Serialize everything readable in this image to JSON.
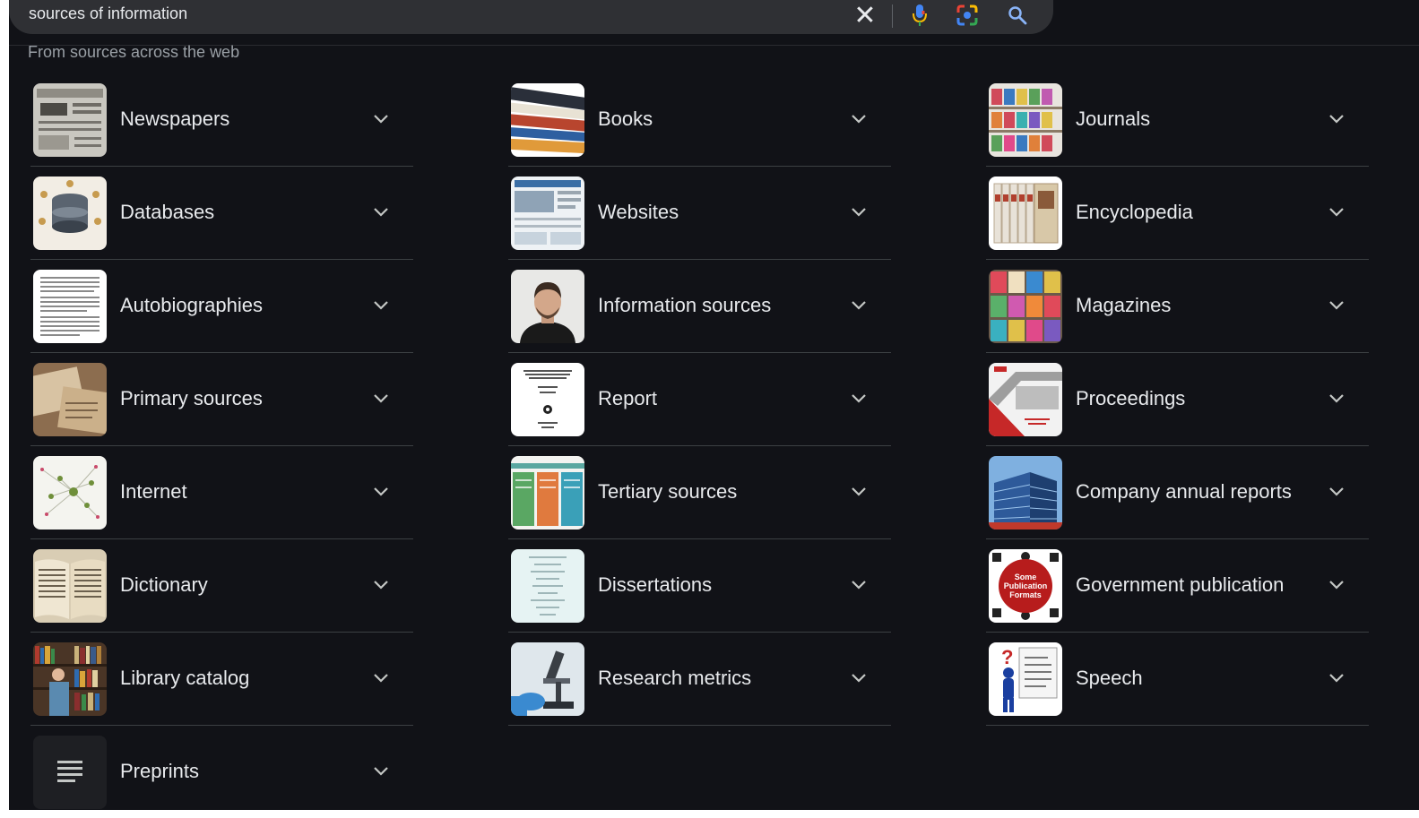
{
  "search": {
    "query": "sources of information"
  },
  "section_label": "From sources across the web",
  "columns": [
    [
      {
        "label": "Newspapers",
        "thumb": "newspaper-thumbnail"
      },
      {
        "label": "Databases",
        "thumb": "database-thumbnail"
      },
      {
        "label": "Autobiographies",
        "thumb": "document-page-thumbnail"
      },
      {
        "label": "Primary sources",
        "thumb": "old-papers-thumbnail"
      },
      {
        "label": "Internet",
        "thumb": "network-map-thumbnail"
      },
      {
        "label": "Dictionary",
        "thumb": "open-book-thumbnail"
      },
      {
        "label": "Library catalog",
        "thumb": "library-shelves-thumbnail"
      },
      {
        "label": "Preprints",
        "thumb": "lines-icon"
      }
    ],
    [
      {
        "label": "Books",
        "thumb": "book-stack-thumbnail"
      },
      {
        "label": "Websites",
        "thumb": "webpage-thumbnail"
      },
      {
        "label": "Information sources",
        "thumb": "person-portrait-thumbnail"
      },
      {
        "label": "Report",
        "thumb": "report-cover-thumbnail"
      },
      {
        "label": "Tertiary sources",
        "thumb": "colored-columns-thumbnail"
      },
      {
        "label": "Dissertations",
        "thumb": "document-list-thumbnail"
      },
      {
        "label": "Research metrics",
        "thumb": "microscope-thumbnail"
      }
    ],
    [
      {
        "label": "Journals",
        "thumb": "magazine-rack-thumbnail"
      },
      {
        "label": "Encyclopedia",
        "thumb": "book-set-thumbnail"
      },
      {
        "label": "Magazines",
        "thumb": "magazine-covers-thumbnail"
      },
      {
        "label": "Proceedings",
        "thumb": "conference-cover-thumbnail"
      },
      {
        "label": "Company annual reports",
        "thumb": "office-building-thumbnail"
      },
      {
        "label": "Government publication",
        "thumb": "publication-formats-thumbnail",
        "thumb_text": "Some Publication Formats"
      },
      {
        "label": "Speech",
        "thumb": "speaker-figure-thumbnail"
      }
    ]
  ],
  "colors": {
    "background": "#111217",
    "search_bar": "#2f3034",
    "text": "#e8eaed",
    "muted_text": "#9aa0a6",
    "divider": "#3c4043",
    "google_blue": "#4285f4",
    "google_red": "#ea4335",
    "google_yellow": "#fbbc04",
    "google_green": "#34a853"
  }
}
